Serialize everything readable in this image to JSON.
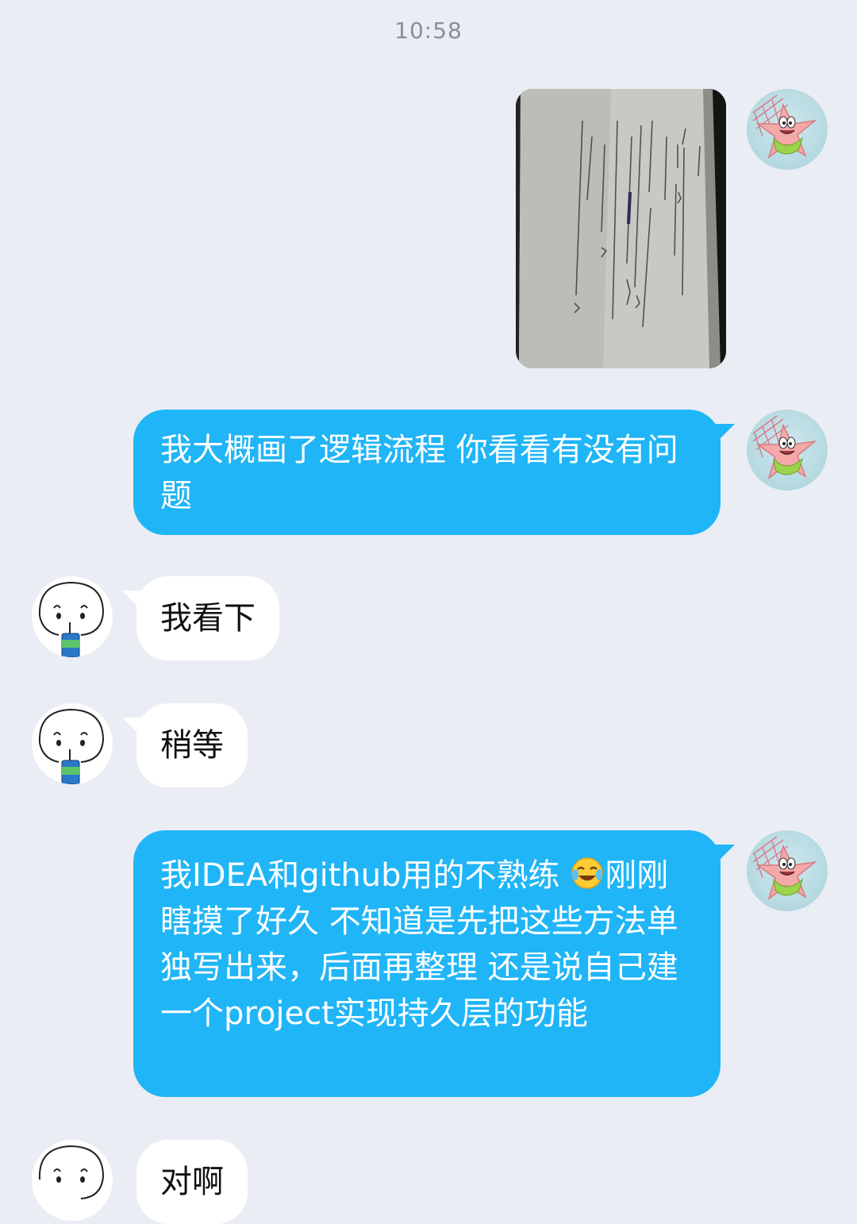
{
  "timestamp": "10:58",
  "messages": [
    {
      "side": "right",
      "type": "image",
      "alt": ""
    },
    {
      "side": "right",
      "type": "text",
      "text": "我大概画了逻辑流程 你看看有没有问题"
    },
    {
      "side": "left",
      "type": "text",
      "text": "我看下"
    },
    {
      "side": "left",
      "type": "text",
      "text": "稍等"
    },
    {
      "side": "right",
      "type": "text",
      "text_before_emoji": "我IDEA和github用的不熟练 ",
      "emoji": "crying-laugh-emoji",
      "text_after_emoji": "刚刚瞎摸了好久 不知道是先把这些方法单独写出来，后面再整理 还是说自己建一个project实现持久层的功能"
    },
    {
      "side": "left",
      "type": "text",
      "text": "对啊"
    }
  ],
  "colors": {
    "background": "#eaedf4",
    "outgoing_bubble": "#20b5f6",
    "incoming_bubble": "#ffffff",
    "timestamp": "#8a8f98"
  },
  "avatars": {
    "self": "patrick-star-avatar-icon",
    "contact": "doodle-face-avatar-icon"
  }
}
